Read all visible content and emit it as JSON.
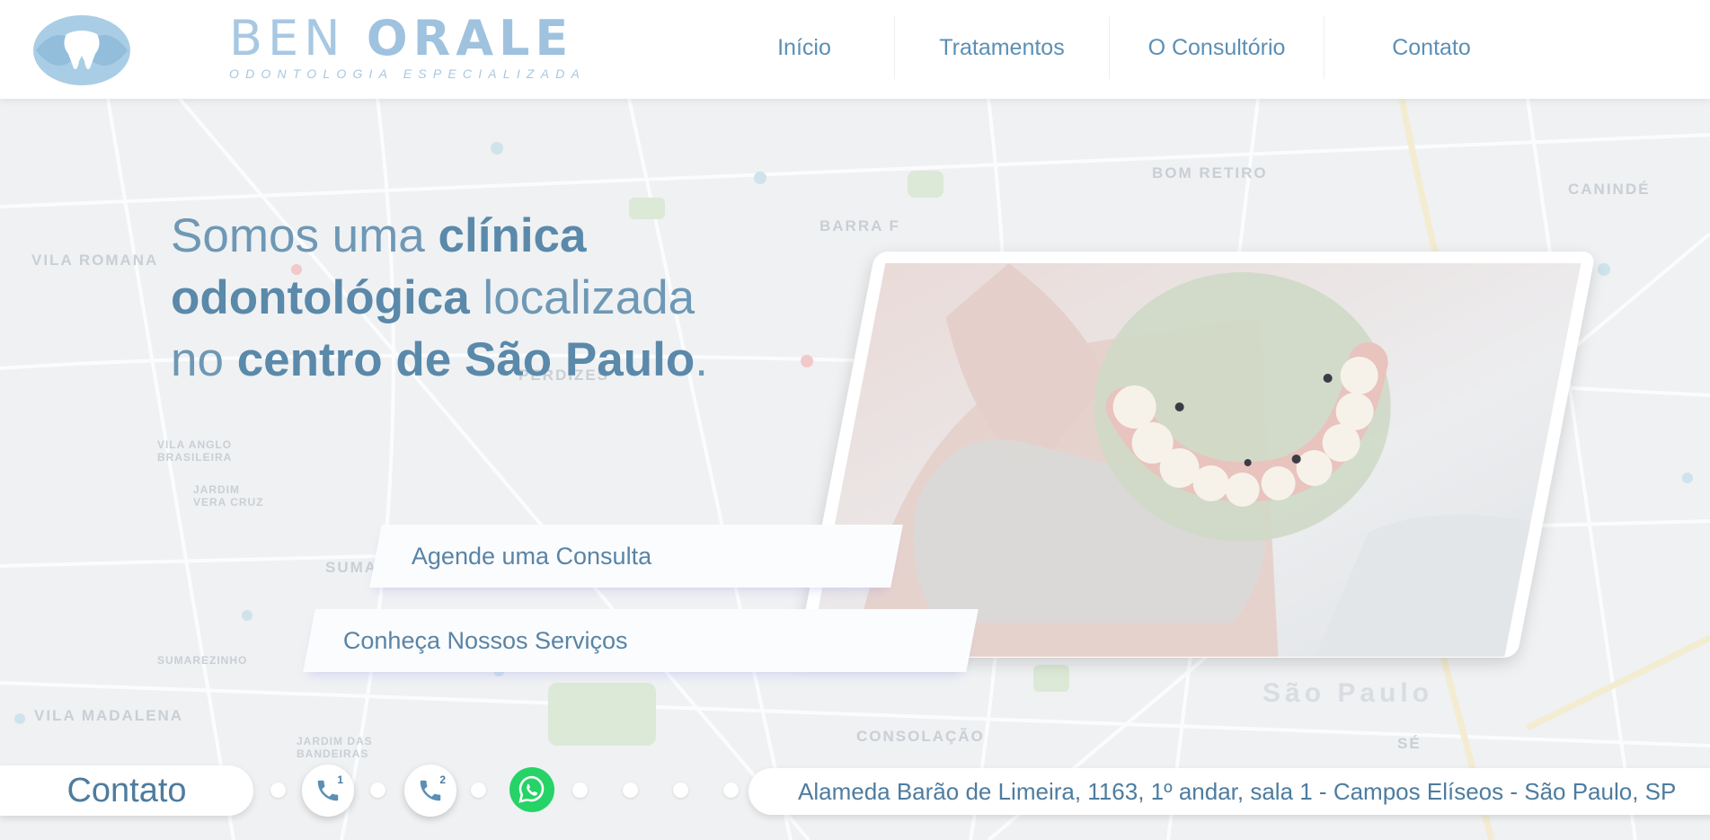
{
  "brand": {
    "name_light": "BEN ",
    "name_bold": "ORALE",
    "tagline": "ODONTOLOGIA ESPECIALIZADA",
    "logo_icon": "tooth-logo-icon"
  },
  "nav": {
    "items": [
      {
        "label": "Início"
      },
      {
        "label": "Tratamentos"
      },
      {
        "label": "O Consultório"
      },
      {
        "label": "Contato"
      }
    ]
  },
  "hero": {
    "headline": {
      "part1": "Somos uma ",
      "bold1": "clínica odontológica",
      "part2": " localizada no ",
      "bold2": "centro de São Paulo",
      "part3": "."
    },
    "cta_primary": "Agende uma Consulta",
    "cta_secondary": "Conheça Nossos Serviços"
  },
  "map_labels": [
    "VILA ROMANA",
    "BOM RETIRO",
    "CANINDÉ",
    "PERDIZES",
    "BARRA F",
    "VILA MADALENA",
    "CONSOLAÇÃO",
    "SÉ",
    "São Paulo",
    "SUMA",
    "VILA ANGLO BRASILEIRA",
    "JARDIM VERA CRUZ",
    "SUMAREZINHO",
    "JARDIM DAS BANDEIRAS"
  ],
  "contact_bar": {
    "label": "Contato",
    "phone1_badge": "1",
    "phone2_badge": "2",
    "address": "Alameda Barão de Limeira, 1163, 1º andar, sala 1 - Campos Elíseos - São Paulo, SP"
  },
  "colors": {
    "brand_blue": "#5b8fb4",
    "light_blue": "#a8c8e2",
    "whatsapp_green": "#25d366"
  }
}
